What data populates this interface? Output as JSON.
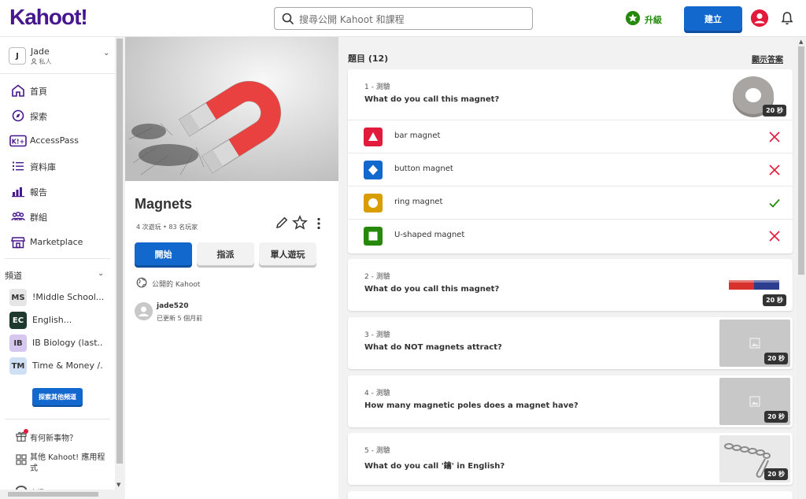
{
  "header": {
    "logo": "Kahoot!",
    "search_placeholder": "搜尋公開 Kahoot 和課程",
    "upgrade_label": "升級",
    "create_label": "建立"
  },
  "sidebar": {
    "user": {
      "initial": "J",
      "name": "Jade",
      "privacy": "私人"
    },
    "nav": [
      {
        "label": "首頁",
        "icon": "home-icon"
      },
      {
        "label": "探索",
        "icon": "compass-icon"
      },
      {
        "label": "AccessPass",
        "icon": "accesspass-icon"
      },
      {
        "label": "資料庫",
        "icon": "list-icon"
      },
      {
        "label": "報告",
        "icon": "bar-chart-icon"
      },
      {
        "label": "群組",
        "icon": "group-icon"
      },
      {
        "label": "Marketplace",
        "icon": "store-icon"
      }
    ],
    "channels_heading": "頻道",
    "channels": [
      {
        "badge": "MS",
        "label": "!Middle School...",
        "bg": "#e6e6e6",
        "fg": "#333333"
      },
      {
        "badge": "EC",
        "label": "English...",
        "bg": "#1e3a2f",
        "fg": "#ffffff"
      },
      {
        "badge": "IB",
        "label": "IB Biology (last...",
        "bg": "#d6c7f0",
        "fg": "#333333"
      },
      {
        "badge": "TM",
        "label": "Time & Money /...",
        "bg": "#cfe0f5",
        "fg": "#333333"
      }
    ],
    "explore_channels_label": "探索其他頻道",
    "whats_new": "有何新事物？",
    "other_apps": "其他 Kahoot! 應用程式",
    "partial_label": "支援"
  },
  "kahoot": {
    "title": "Magnets",
    "stats": "4 次遊玩 • 83 名玩家",
    "start_label": "開始",
    "assign_label": "指派",
    "solo_label": "單人遊玩",
    "visibility": "公開的 Kahoot",
    "creator": "jade520",
    "updated": "已更新 5 個月前"
  },
  "questions": {
    "heading": "題目 (12)",
    "show_answers": "顯示答案",
    "items": [
      {
        "number": "1 - 測驗",
        "text": "What do you call this magnet?",
        "time": "20 秒",
        "answers": [
          {
            "label": "bar magnet",
            "shape": "triangle",
            "color": "#e21b3c",
            "correct": false
          },
          {
            "label": "button magnet",
            "shape": "diamond",
            "color": "#1368ce",
            "correct": false
          },
          {
            "label": "ring magnet",
            "shape": "circle",
            "color": "#d89e00",
            "correct": true
          },
          {
            "label": "U-shaped magnet",
            "shape": "square",
            "color": "#26890c",
            "correct": false
          }
        ]
      },
      {
        "number": "2 - 測驗",
        "text": "What do you call this magnet?",
        "time": "20 秒"
      },
      {
        "number": "3 - 測驗",
        "text": "What do NOT magnets attract?",
        "time": "20 秒"
      },
      {
        "number": "4 - 測驗",
        "text": "How many magnetic poles does a magnet have?",
        "time": "20 秒"
      },
      {
        "number": "5 - 測驗",
        "text": "What do you call '鑰' in English?",
        "time": "20 秒"
      }
    ]
  },
  "colors": {
    "brand": "#46178f",
    "primary": "#1368ce",
    "correct": "#26890c",
    "wrong": "#e21b3c"
  }
}
